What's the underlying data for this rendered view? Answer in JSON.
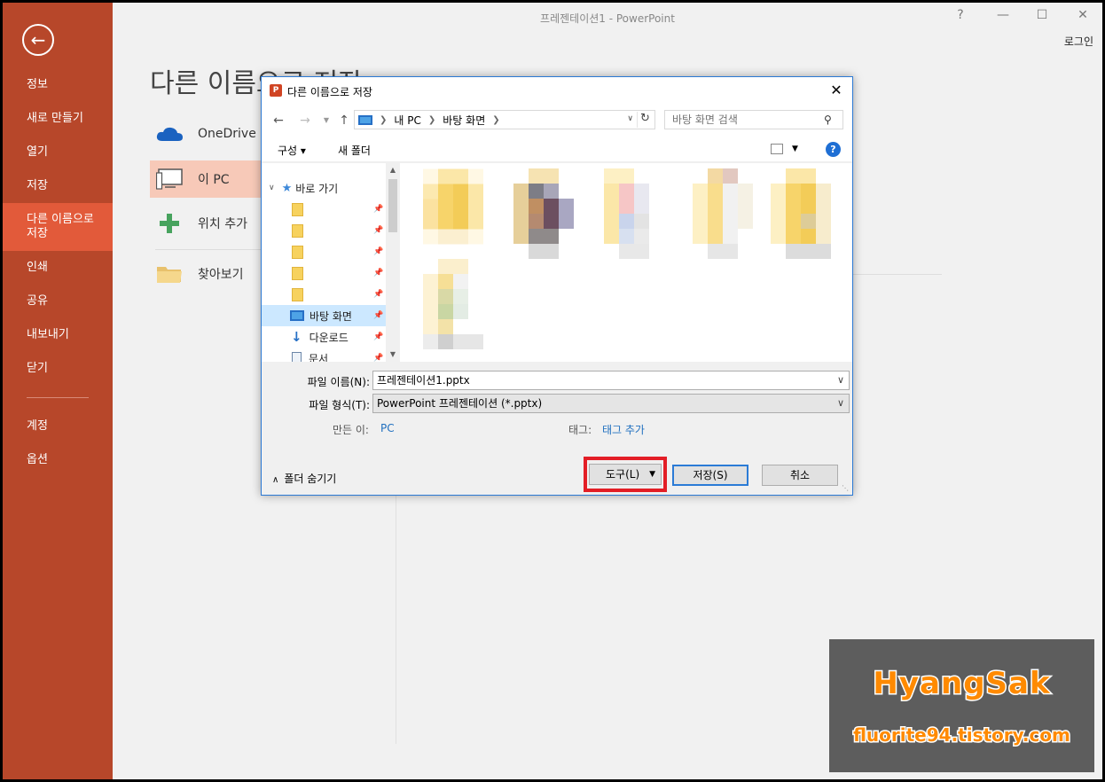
{
  "window": {
    "title": "프레젠테이션1 - PowerPoint",
    "help": "?",
    "login": "로그인"
  },
  "sidebar": {
    "items": [
      {
        "label": "정보"
      },
      {
        "label": "새로 만들기"
      },
      {
        "label": "열기"
      },
      {
        "label": "저장"
      },
      {
        "label": "다른 이름으로\n저장",
        "active": true
      },
      {
        "label": "인쇄"
      },
      {
        "label": "공유"
      },
      {
        "label": "내보내기"
      },
      {
        "label": "닫기"
      }
    ],
    "bottom_items": [
      {
        "label": "계정"
      },
      {
        "label": "옵션"
      }
    ],
    "accent_color": "#b7472a",
    "active_color": "#e25a3a"
  },
  "backstage": {
    "heading": "다른 이름으로 저장",
    "places": [
      {
        "label": "OneDrive",
        "icon": "cloud-icon"
      },
      {
        "label": "이 PC",
        "icon": "computer-icon",
        "selected": true
      },
      {
        "label": "위치 추가",
        "icon": "plus-icon"
      },
      {
        "label": "찾아보기",
        "icon": "folder-icon"
      }
    ]
  },
  "dialog": {
    "title": "다른 이름으로 저장",
    "app_icon_letter": "P",
    "address": {
      "crumbs": [
        "내 PC",
        "바탕 화면"
      ]
    },
    "search_placeholder": "바탕 화면 검색",
    "toolbar": {
      "organize": "구성 ▾",
      "new_folder": "새 폴더"
    },
    "tree": {
      "quick_access": "바로 가기",
      "desktop": "바탕 화면",
      "downloads": "다운로드",
      "documents": "문서"
    },
    "form": {
      "filename_label": "파일 이름(N):",
      "filename_value": "프레젠테이션1.pptx",
      "filetype_label": "파일 형식(T):",
      "filetype_value": "PowerPoint 프레젠테이션 (*.pptx)",
      "author_label": "만든 이:",
      "author_value": "PC",
      "tags_label": "태그:",
      "tags_value": "태그 추가"
    },
    "buttons": {
      "hide_folders": "폴더 숨기기",
      "tools": "도구(L)",
      "save": "저장(S)",
      "cancel": "취소"
    },
    "highlight_color": "#e31e26"
  },
  "watermark": {
    "line1": "HyangSak",
    "line2": "fluorite94.tistory.com"
  }
}
